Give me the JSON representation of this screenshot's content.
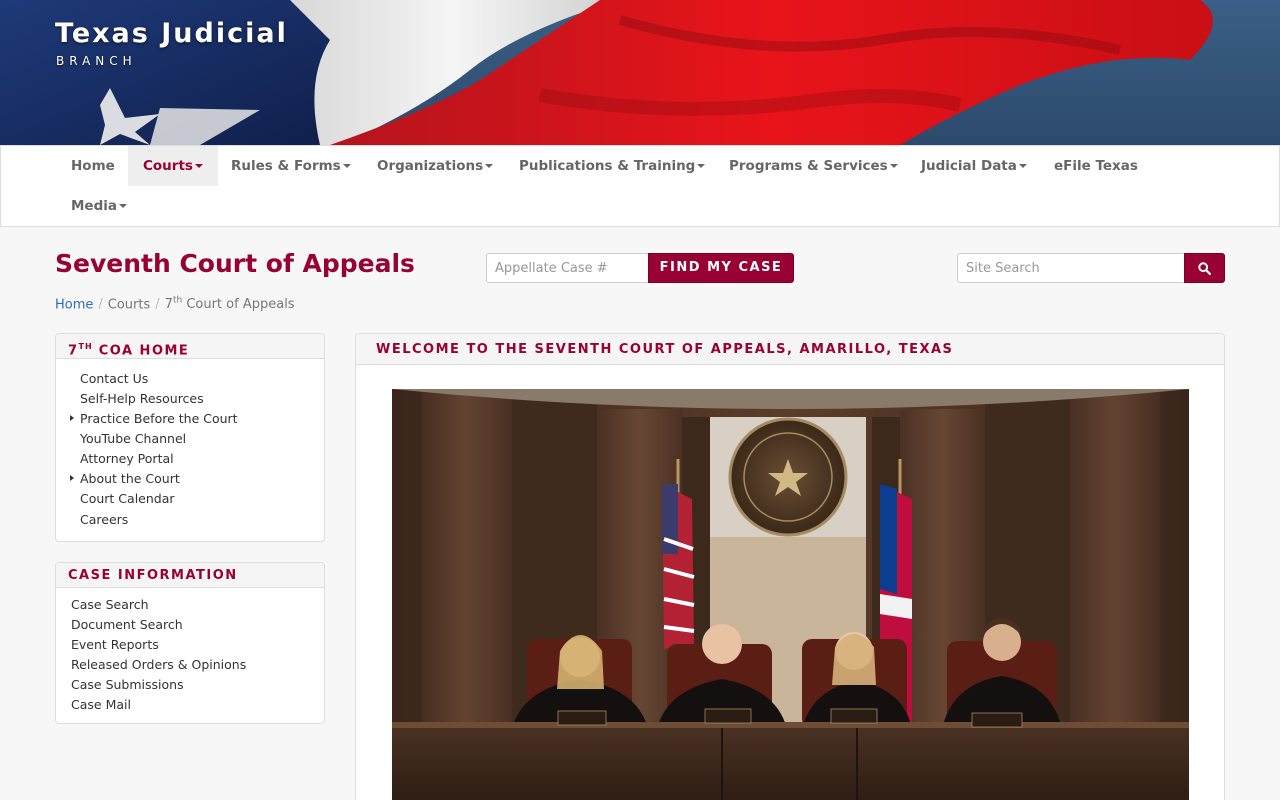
{
  "brand": {
    "title": "Texas Judicial",
    "subtitle": "BRANCH"
  },
  "nav": {
    "items": [
      {
        "label": "Home",
        "dropdown": false
      },
      {
        "label": "Courts",
        "dropdown": true,
        "active": true
      },
      {
        "label": "Rules & Forms",
        "dropdown": true
      },
      {
        "label": "Organizations",
        "dropdown": true
      },
      {
        "label": "Publications & Training",
        "dropdown": true
      },
      {
        "label": "Programs & Services",
        "dropdown": true
      },
      {
        "label": "Judicial Data",
        "dropdown": true
      },
      {
        "label": "eFile Texas",
        "dropdown": false
      },
      {
        "label": "Media",
        "dropdown": true
      }
    ]
  },
  "page": {
    "title": "Seventh Court of Appeals"
  },
  "case_search": {
    "placeholder": "Appellate Case #",
    "button_label": "FIND MY CASE"
  },
  "site_search": {
    "placeholder": "Site Search",
    "icon": "search-icon"
  },
  "breadcrumb": {
    "home": "Home",
    "courts": "Courts",
    "current_ordinal": "7",
    "current_suffix": "th",
    "current_rest": " Court of Appeals"
  },
  "coa_panel": {
    "heading_num": "7",
    "heading_sup": "TH",
    "heading_rest": " COA HOME",
    "items": [
      {
        "label": "Contact Us",
        "expandable": false
      },
      {
        "label": "Self-Help Resources",
        "expandable": false
      },
      {
        "label": "Practice Before the Court",
        "expandable": true
      },
      {
        "label": "YouTube Channel",
        "expandable": false
      },
      {
        "label": "Attorney Portal",
        "expandable": false
      },
      {
        "label": "About the Court",
        "expandable": true
      },
      {
        "label": "Court Calendar",
        "expandable": false
      },
      {
        "label": "Careers",
        "expandable": false
      }
    ]
  },
  "case_info_panel": {
    "heading": "CASE INFORMATION",
    "items": [
      {
        "label": "Case Search"
      },
      {
        "label": "Document Search"
      },
      {
        "label": "Event Reports"
      },
      {
        "label": "Released Orders & Opinions"
      },
      {
        "label": "Case Submissions"
      },
      {
        "label": "Case Mail"
      }
    ]
  },
  "welcome": {
    "heading": "WELCOME TO THE SEVENTH COURT OF APPEALS, AMARILLO, TEXAS",
    "seal_text": "THE STATE OF TEXAS",
    "nameplates": [
      "LAURA PRATT",
      "LAWRENCE M. DOSS",
      "JUDY C. PARKER",
      "ALEX YARBROUGH"
    ]
  },
  "colors": {
    "brand": "#990033",
    "link": "#2a6ebb",
    "nav_text": "#666666"
  }
}
